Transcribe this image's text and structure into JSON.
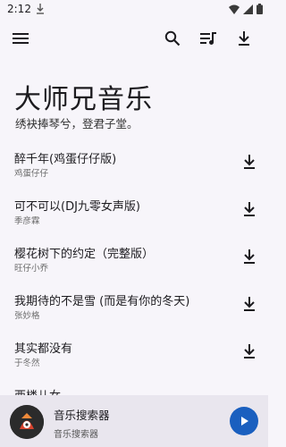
{
  "status_bar": {
    "time": "2:12"
  },
  "app_bar": {
    "menu_icon": "menu-icon",
    "search_icon": "search-icon",
    "queue_icon": "queue-music-icon",
    "download_icon": "download-icon"
  },
  "header": {
    "title": "大师兄音乐",
    "subtitle": "绣袂捧琴兮，登君子堂。"
  },
  "songs": [
    {
      "title": "醉千年(鸡蛋仔仔版)",
      "artist": "鸡蛋仔仔"
    },
    {
      "title": "可不可以(DJ九零女声版)",
      "artist": "季彦霖"
    },
    {
      "title": "樱花树下的约定（完整版）",
      "artist": "旺仔小乔"
    },
    {
      "title": "我期待的不是雪 (而是有你的冬天)",
      "artist": "张妙格"
    },
    {
      "title": "其实都没有",
      "artist": "于冬然"
    },
    {
      "title": "西楼儿女",
      "artist": ""
    }
  ],
  "player": {
    "title": "音乐搜索器",
    "subtitle": "音乐搜索器"
  },
  "colors": {
    "background": "#f7f5fa",
    "player_bar": "#e9e6ee",
    "play_button": "#1a5fbf"
  }
}
